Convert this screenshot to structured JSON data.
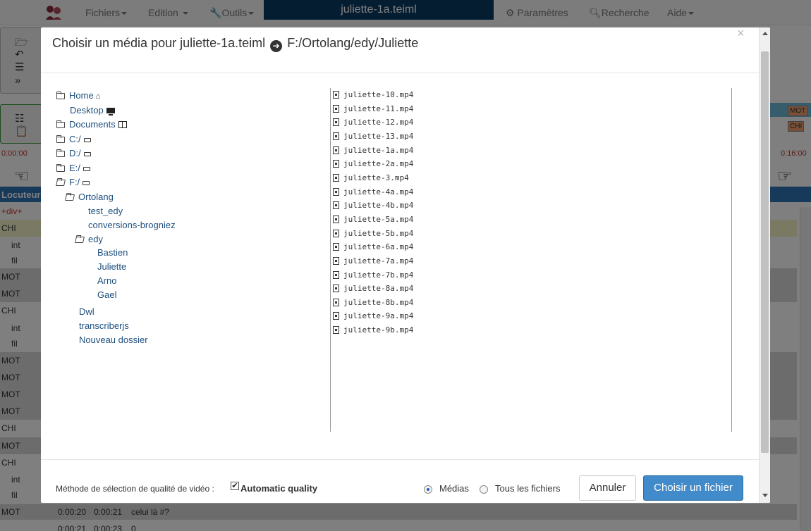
{
  "navbar": {
    "menu_files": "Fichiers",
    "menu_edit": "Edition",
    "menu_tools": "Outils",
    "document_title": "juliette-1a.teiml",
    "menu_settings": "Paramètres",
    "menu_search": "Recherche",
    "menu_help": "Aide"
  },
  "background": {
    "time_start": "0:00:00",
    "time_end": "0:16:00",
    "header_label": "Locuteur",
    "chip_mot": "MOT",
    "chip_chi": "CHI",
    "rows": [
      {
        "label": "+div+"
      },
      {
        "label": "CHI"
      },
      {
        "label": "int"
      },
      {
        "label": "fil"
      },
      {
        "label": "MOT"
      },
      {
        "label": "MOT"
      },
      {
        "label": "CHI"
      },
      {
        "label": "int"
      },
      {
        "label": "fil"
      },
      {
        "label": "MOT"
      },
      {
        "label": "MOT"
      },
      {
        "label": "MOT"
      },
      {
        "label": "MOT"
      },
      {
        "label": "CHI"
      },
      {
        "label": "MOT"
      },
      {
        "label": "CHI"
      },
      {
        "label": "int"
      },
      {
        "label": "fil"
      }
    ],
    "bottom_row_1": {
      "speaker": "MOT",
      "start": "0:00:20",
      "end": "0:00:21",
      "text": "celui là #?"
    },
    "bottom_row_2": {
      "start": "0:00:21",
      "end": "0:00:23",
      "text": "0"
    }
  },
  "modal": {
    "title_prefix": "Choisir un média pour juliette-1a.teiml",
    "title_path": "F:/Ortolang/edy/Juliette",
    "close_symbol": "×",
    "tree": [
      {
        "label": "Home"
      },
      {
        "label": "Desktop"
      },
      {
        "label": "Documents"
      },
      {
        "label": "C:/"
      },
      {
        "label": "D:/"
      },
      {
        "label": "E:/"
      },
      {
        "label": "F:/"
      },
      {
        "label": "Ortolang"
      },
      {
        "label": "test_edy"
      },
      {
        "label": "conversions-brogniez"
      },
      {
        "label": "edy"
      },
      {
        "label": "Bastien"
      },
      {
        "label": "Juliette"
      },
      {
        "label": "Arno"
      },
      {
        "label": "Gael"
      },
      {
        "label": "Dwl"
      },
      {
        "label": "transcriberjs"
      },
      {
        "label": "Nouveau dossier"
      }
    ],
    "files": [
      "juliette-10.mp4",
      "juliette-11.mp4",
      "juliette-12.mp4",
      "juliette-13.mp4",
      "juliette-1a.mp4",
      "juliette-2a.mp4",
      "juliette-3.mp4",
      "juliette-4a.mp4",
      "juliette-4b.mp4",
      "juliette-5a.mp4",
      "juliette-5b.mp4",
      "juliette-6a.mp4",
      "juliette-7a.mp4",
      "juliette-7b.mp4",
      "juliette-8a.mp4",
      "juliette-8b.mp4",
      "juliette-9a.mp4",
      "juliette-9b.mp4"
    ],
    "footer": {
      "quality_label": "Méthode de sélection de qualité de vidéo :",
      "auto_quality_label": "Automatic quality",
      "auto_quality_checked": true,
      "radio_media_label": "Médias",
      "radio_all_label": "Tous les fichiers",
      "selected_filter": "Médias",
      "cancel_label": "Annuler",
      "choose_label": "Choisir un fichier"
    }
  }
}
